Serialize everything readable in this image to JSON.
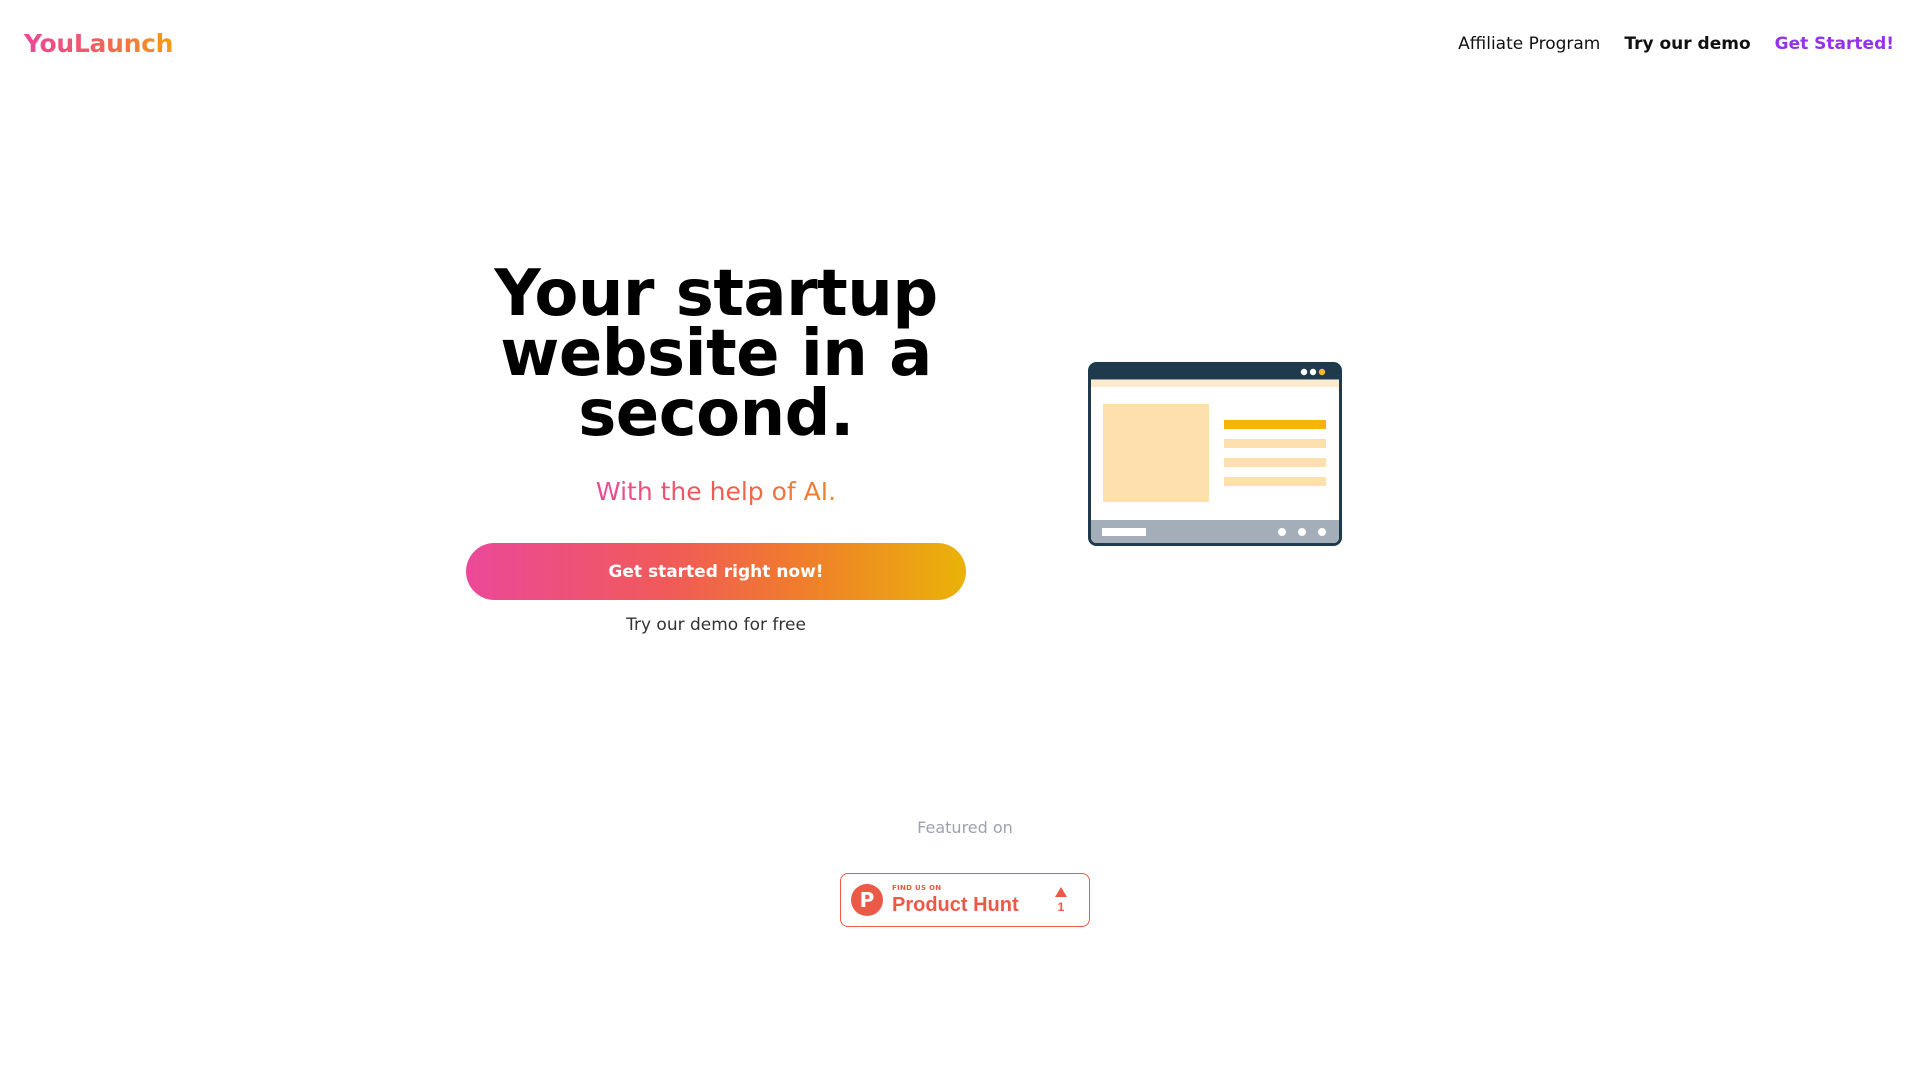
{
  "header": {
    "logo_text": "YouLaunch",
    "nav": {
      "affiliate_label": "Affiliate Program",
      "demo_label": "Try our demo",
      "get_started_label": "Get Started!"
    }
  },
  "hero": {
    "title_line1": "Your startup",
    "title_line2": "website in a",
    "title_line3": "second.",
    "subtitle": "With the help of AI.",
    "cta_label": "Get started right now!",
    "cta_sub_label": "Try our demo for free"
  },
  "featured": {
    "label": "Featured on",
    "badge": {
      "kicker": "FIND US ON",
      "name": "Product Hunt",
      "logo_letter": "P",
      "upvotes": "1"
    }
  },
  "colors": {
    "brand_pink": "#ec4899",
    "brand_orange": "#f59e0b",
    "nav_accent_purple": "#9333ea",
    "product_hunt": "#ea5a47",
    "illustration_frame": "#1e3a4c"
  },
  "icons": {
    "illustration": "browser-window-illustration",
    "badge_logo": "product-hunt-logo-icon",
    "upvote": "upvote-arrow-icon"
  }
}
